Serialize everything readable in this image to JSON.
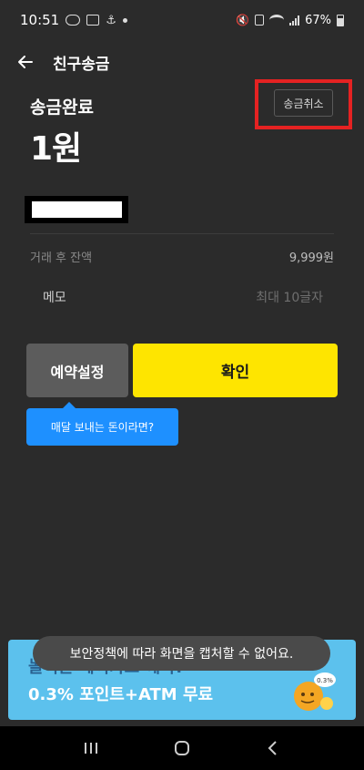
{
  "status_bar": {
    "time": "10:51",
    "battery": "67%"
  },
  "header": {
    "title": "친구송금",
    "back_icon": "arrow-left-icon"
  },
  "result": {
    "done_label": "송금완료",
    "amount": "1원",
    "cancel_label": "송금취소"
  },
  "details": {
    "balance_label": "거래 후 잔액",
    "balance_value": "9,999원",
    "memo_label": "메모",
    "memo_placeholder": "최대 10글자"
  },
  "actions": {
    "reserve_label": "예약설정",
    "confirm_label": "확인",
    "tooltip": "매달 보내는 돈이라면?"
  },
  "banner": {
    "line1": "놀이는 페이카드 예약!",
    "line2": "0.3% 포인트+ATM 무료",
    "coin_text": "0.3%"
  },
  "toast": "보안정책에 따라 화면을 캡처할 수 없어요.",
  "colors": {
    "background": "#2b2b2b",
    "confirm": "#fee500",
    "tooltip": "#1e90ff",
    "banner": "#5cc1ed",
    "highlight": "#e52222"
  }
}
